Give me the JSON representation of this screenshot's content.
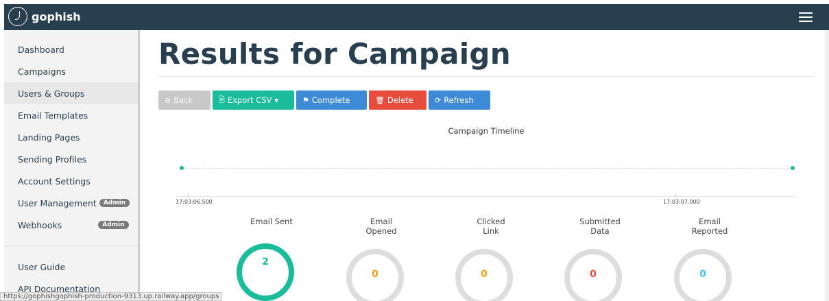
{
  "brand": {
    "name": "gophish"
  },
  "sidebar": {
    "items": [
      {
        "label": "Dashboard"
      },
      {
        "label": "Campaigns"
      },
      {
        "label": "Users & Groups"
      },
      {
        "label": "Email Templates"
      },
      {
        "label": "Landing Pages"
      },
      {
        "label": "Sending Profiles"
      },
      {
        "label": "Account Settings"
      },
      {
        "label": "User Management",
        "badge": "Admin"
      },
      {
        "label": "Webhooks",
        "badge": "Admin"
      }
    ],
    "footer_items": [
      {
        "label": "User Guide"
      },
      {
        "label": "API Documentation"
      }
    ]
  },
  "main": {
    "title": "Results for Campaign",
    "buttons": {
      "back": "Back",
      "export": "Export CSV",
      "complete": "Complete",
      "delete": "Delete",
      "refresh": "Refresh"
    },
    "timeline": {
      "title": "Campaign Timeline",
      "start_label": "17:03:06.500",
      "end_label": "17:03:07.000"
    },
    "stats": [
      {
        "label_line1": "Email Sent",
        "label_line2": "",
        "value": "2",
        "color": "#1abc9c"
      },
      {
        "label_line1": "Email",
        "label_line2": "Opened",
        "value": "0",
        "color": "#f39c12"
      },
      {
        "label_line1": "Clicked",
        "label_line2": "Link",
        "value": "0",
        "color": "#f39c12"
      },
      {
        "label_line1": "Submitted",
        "label_line2": "Data",
        "value": "0",
        "color": "#e74c3c"
      },
      {
        "label_line1": "Email",
        "label_line2": "Reported",
        "value": "0",
        "color": "#3ec5e5"
      }
    ]
  },
  "statusbar": {
    "url": "https://gophishgophish-production-9313.up.railway.app/groups"
  },
  "colors": {
    "nav": "#283f50",
    "accent": "#1abc9c",
    "ring_track": "#dddddd"
  }
}
